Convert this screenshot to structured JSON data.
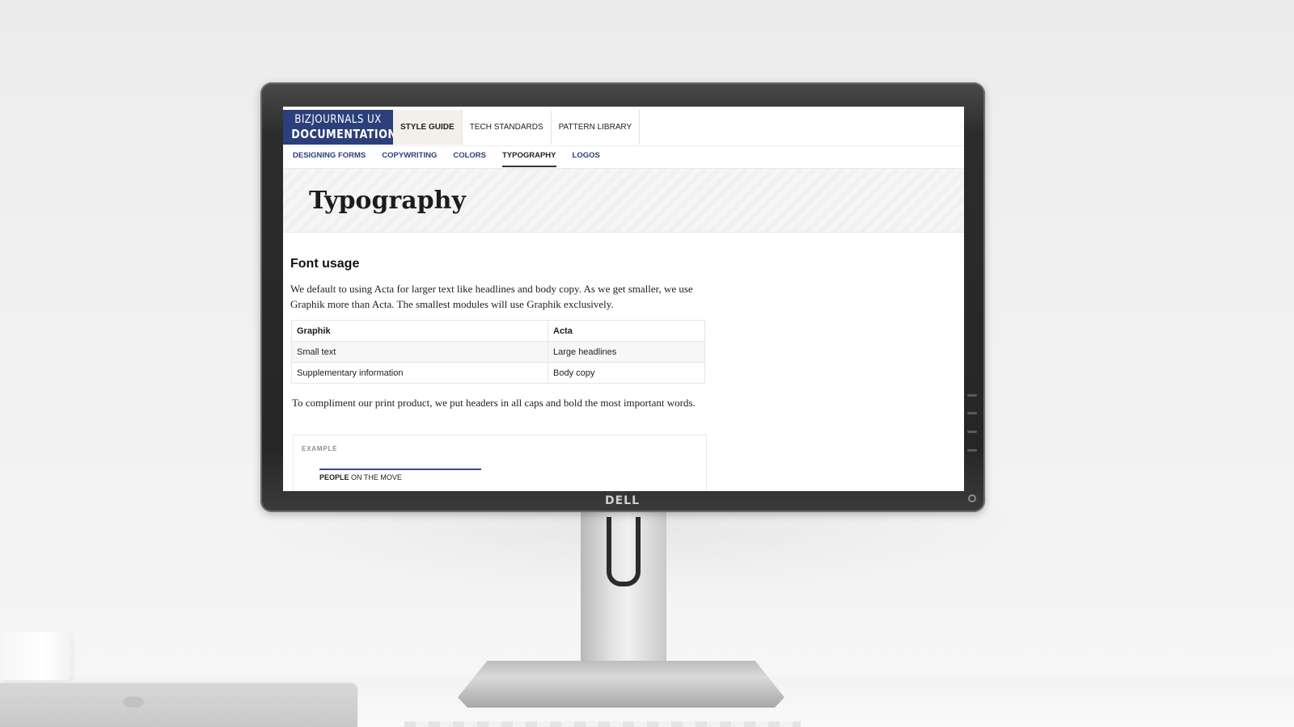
{
  "logo": {
    "line1": "BIZJOURNALS UX",
    "line2": "DOCUMENTATION"
  },
  "main_nav": {
    "tabs": [
      {
        "label": "STYLE GUIDE",
        "active": true
      },
      {
        "label": "TECH STANDARDS",
        "active": false
      },
      {
        "label": "PATTERN LIBRARY",
        "active": false
      }
    ]
  },
  "sub_nav": {
    "tabs": [
      {
        "label": "DESIGNING FORMS",
        "active": false
      },
      {
        "label": "COPYWRITING",
        "active": false
      },
      {
        "label": "COLORS",
        "active": false
      },
      {
        "label": "TYPOGRAPHY",
        "active": true
      },
      {
        "label": "LOGOS",
        "active": false
      }
    ]
  },
  "page": {
    "title": "Typography",
    "section_heading": "Font usage",
    "intro": "We default to using Acta for larger text like headlines and body copy. As we get smaller, we use Graphik more than Acta. The smallest modules will use Graphik exclusively.",
    "table": {
      "headers": [
        "Graphik",
        "Acta"
      ],
      "rows": [
        [
          "Small text",
          "Large headlines"
        ],
        [
          "Supplementary information",
          "Body copy"
        ]
      ]
    },
    "caps_note": "To compliment our print product, we put headers in all caps and bold the most important words.",
    "example": {
      "label": "EXAMPLE",
      "strong": "PEOPLE",
      "rest": " ON THE MOVE"
    }
  },
  "hardware": {
    "brand": "DELL"
  },
  "colors": {
    "brand_blue": "#2b3f7a",
    "active_tab_bg": "#f3f0ea"
  }
}
